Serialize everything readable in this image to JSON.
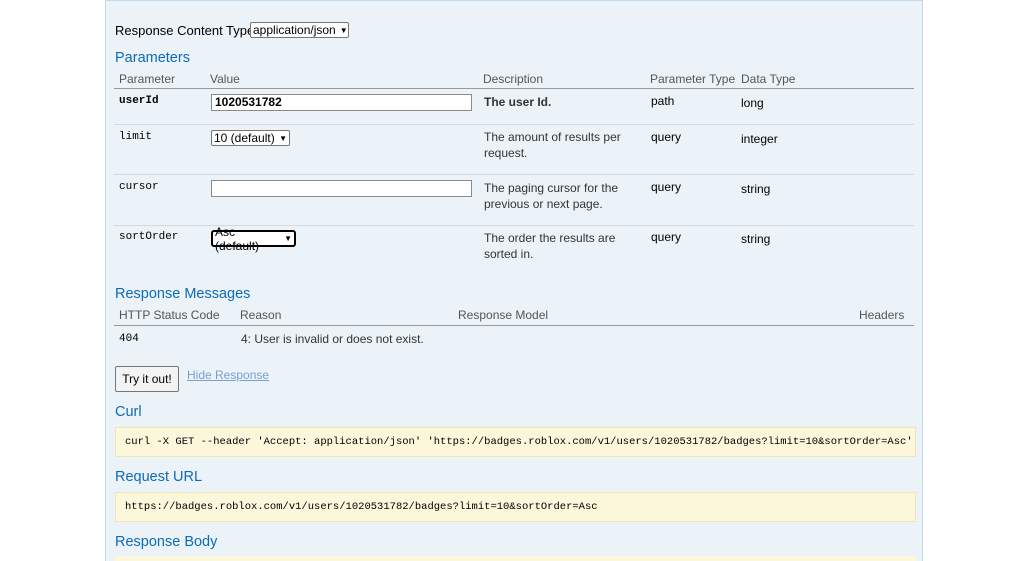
{
  "response_content_type": {
    "label": "Response Content Type",
    "selected": "application/json"
  },
  "parameters": {
    "heading": "Parameters",
    "columns": [
      "Parameter",
      "Value",
      "Description",
      "Parameter Type",
      "Data Type"
    ],
    "rows": [
      {
        "name": "userId",
        "value": "1020531782",
        "description": "The user Id.",
        "param_type": "path",
        "data_type": "long",
        "control": "input"
      },
      {
        "name": "limit",
        "value": "10 (default)",
        "description": "The amount of results per request.",
        "param_type": "query",
        "data_type": "integer",
        "control": "select"
      },
      {
        "name": "cursor",
        "value": "",
        "description": "The paging cursor for the previous or next page.",
        "param_type": "query",
        "data_type": "string",
        "control": "input"
      },
      {
        "name": "sortOrder",
        "value": "Asc (default)",
        "description": "The order the results are sorted in.",
        "param_type": "query",
        "data_type": "string",
        "control": "select"
      }
    ]
  },
  "response_messages": {
    "heading": "Response Messages",
    "columns": [
      "HTTP Status Code",
      "Reason",
      "Response Model",
      "Headers"
    ],
    "rows": [
      {
        "code": "404",
        "reason": "4: User is invalid or does not exist.",
        "model": "",
        "headers": ""
      }
    ]
  },
  "actions": {
    "try_label": "Try it out!",
    "hide_label": "Hide Response"
  },
  "curl": {
    "heading": "Curl",
    "command": "curl -X GET --header 'Accept: application/json' 'https://badges.roblox.com/v1/users/1020531782/badges?limit=10&sortOrder=Asc'"
  },
  "request_url": {
    "heading": "Request URL",
    "url": "https://badges.roblox.com/v1/users/1020531782/badges?limit=10&sortOrder=Asc"
  },
  "response_body": {
    "heading": "Response Body"
  },
  "colors": {
    "panel_bg": "#ebf3f9",
    "heading_blue": "#0f6ab4",
    "code_bg": "#fcf6db"
  }
}
